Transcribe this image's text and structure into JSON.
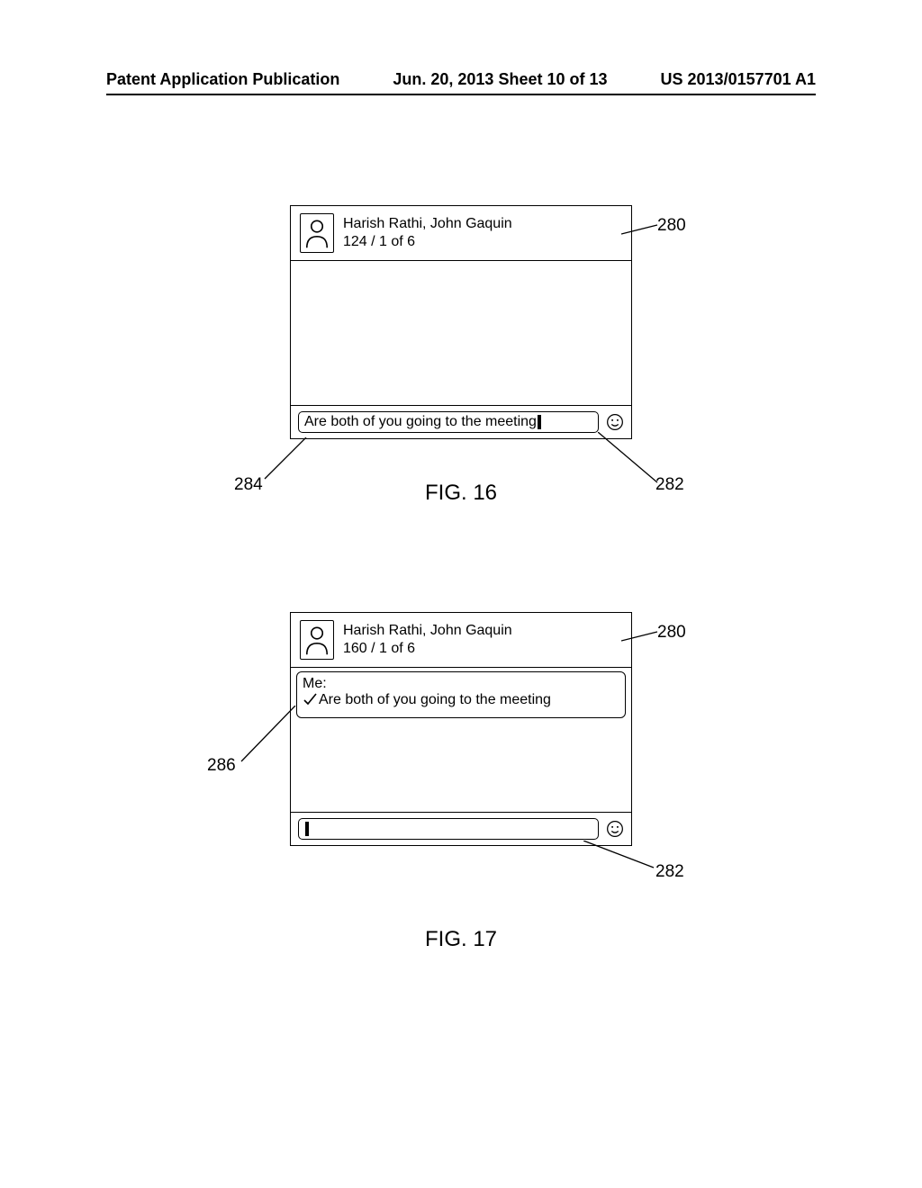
{
  "header": {
    "left": "Patent Application Publication",
    "center": "Jun. 20, 2013  Sheet 10 of 13",
    "right": "US 2013/0157701 A1"
  },
  "fig16": {
    "caption": "FIG. 16",
    "participants": "Harish Rathi, John Gaquin",
    "counter": "124 / 1 of 6",
    "input_text": "Are both of you going to the meeting",
    "callouts": {
      "window": "280",
      "emoji": "282",
      "input": "284"
    }
  },
  "fig17": {
    "caption": "FIG. 17",
    "participants": "Harish Rathi, John Gaquin",
    "counter": "160 / 1 of 6",
    "msg_sender": "Me:",
    "msg_body": "Are both of you going to the meeting",
    "callouts": {
      "window": "280",
      "emoji": "282",
      "bubble": "286"
    }
  }
}
